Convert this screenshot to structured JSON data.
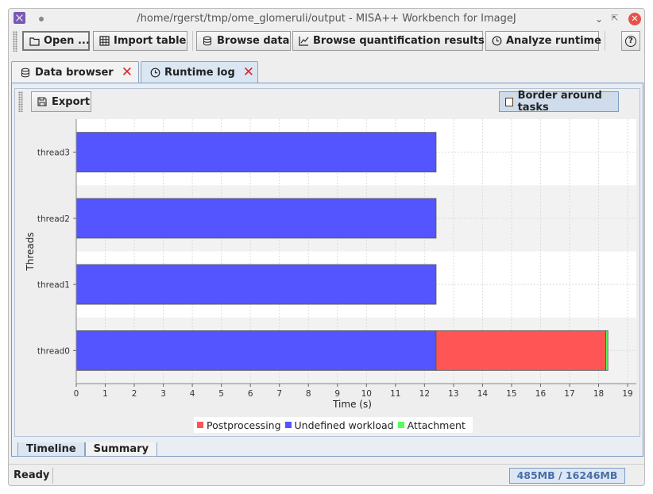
{
  "window": {
    "title": "/home/rgerst/tmp/ome_glomeruli/output - MISA++ Workbench for ImageJ"
  },
  "toolbar": {
    "open_label": "Open ...",
    "import_table_label": "Import table",
    "browse_data_label": "Browse data",
    "browse_quant_label": "Browse quantification results",
    "analyze_runtime_label": "Analyze runtime",
    "help_label": "?"
  },
  "tabs": [
    {
      "label": "Data browser",
      "icon": "database-icon",
      "active": false
    },
    {
      "label": "Runtime log",
      "icon": "clock-icon",
      "active": true
    }
  ],
  "panel": {
    "export_label": "Export",
    "border_toggle_label": "Border around tasks",
    "border_toggle_checked": false
  },
  "chart_data": {
    "type": "bar",
    "orientation": "horizontal-stacked-timeline",
    "ylabel": "Threads",
    "xlabel": "Time (s)",
    "xlim": [
      0,
      19.3
    ],
    "xticks": [
      0,
      1,
      2,
      3,
      4,
      5,
      6,
      7,
      8,
      9,
      10,
      11,
      12,
      13,
      14,
      15,
      16,
      17,
      18,
      19
    ],
    "categories": [
      "thread3",
      "thread2",
      "thread1",
      "thread0"
    ],
    "grid": true,
    "legend_position": "bottom",
    "series": [
      {
        "name": "Postprocessing",
        "color": "#ff5555"
      },
      {
        "name": "Undefined workload",
        "color": "#5555ff"
      },
      {
        "name": "Attachment",
        "color": "#55ff55"
      }
    ],
    "tasks": [
      {
        "thread": "thread3",
        "series": "Undefined workload",
        "start": 0,
        "end": 12.4
      },
      {
        "thread": "thread2",
        "series": "Undefined workload",
        "start": 0,
        "end": 12.4
      },
      {
        "thread": "thread1",
        "series": "Undefined workload",
        "start": 0,
        "end": 12.4
      },
      {
        "thread": "thread0",
        "series": "Undefined workload",
        "start": 0,
        "end": 12.4
      },
      {
        "thread": "thread0",
        "series": "Postprocessing",
        "start": 12.4,
        "end": 18.25
      },
      {
        "thread": "thread0",
        "series": "Attachment",
        "start": 18.25,
        "end": 18.32
      }
    ]
  },
  "subtabs": [
    {
      "label": "Timeline",
      "active": true
    },
    {
      "label": "Summary",
      "active": false
    }
  ],
  "status": {
    "text": "Ready",
    "memory": "485MB / 16246MB"
  }
}
